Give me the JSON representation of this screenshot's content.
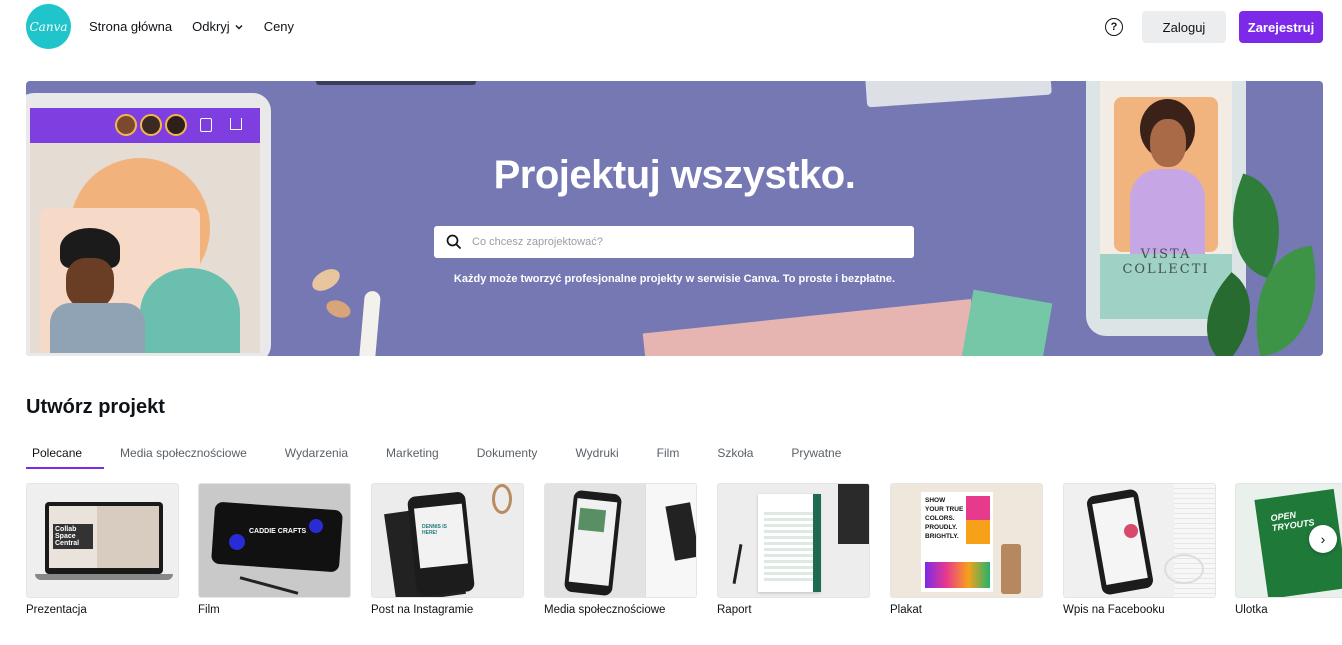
{
  "header": {
    "logo_text": "Canva",
    "nav": [
      {
        "label": "Strona główna"
      },
      {
        "label": "Odkryj"
      },
      {
        "label": "Ceny"
      }
    ],
    "help_symbol": "?",
    "login_label": "Zaloguj",
    "signup_label": "Zarejestruj"
  },
  "hero": {
    "title": "Projektuj wszystko.",
    "search_placeholder": "Co chcesz zaprojektować?",
    "subtitle": "Każdy może tworzyć profesjonalne projekty w serwisie Canva. To proste i bezpłatne.",
    "phone_text_line1": "VISTA",
    "phone_text_line2": "COLLECTI"
  },
  "create": {
    "title": "Utwórz projekt",
    "tabs": [
      {
        "label": "Polecane"
      },
      {
        "label": "Media społecznościowe"
      },
      {
        "label": "Wydarzenia"
      },
      {
        "label": "Marketing"
      },
      {
        "label": "Dokumenty"
      },
      {
        "label": "Wydruki"
      },
      {
        "label": "Film"
      },
      {
        "label": "Szkoła"
      },
      {
        "label": "Prywatne"
      }
    ],
    "cards": [
      {
        "label": "Prezentacja",
        "thumb_text": "Collab Space Central"
      },
      {
        "label": "Film",
        "thumb_text": "CADDIE CRAFTS"
      },
      {
        "label": "Post na Instagramie",
        "thumb_text": "DENNIS IS HERE!"
      },
      {
        "label": "Media społecznościowe",
        "thumb_text": ""
      },
      {
        "label": "Raport",
        "thumb_text": ""
      },
      {
        "label": "Plakat",
        "thumb_text": "SHOW YOUR TRUE COLORS. PROUDLY. BRIGHTLY."
      },
      {
        "label": "Wpis na Facebooku",
        "thumb_text": ""
      },
      {
        "label": "Ulotka",
        "thumb_text": "OPEN TRYOUTS"
      }
    ],
    "next_symbol": "›"
  },
  "colors": {
    "brand_purple": "#7d2ae8",
    "logo_teal": "#20c4cb",
    "hero_bg": "#7678b4"
  }
}
